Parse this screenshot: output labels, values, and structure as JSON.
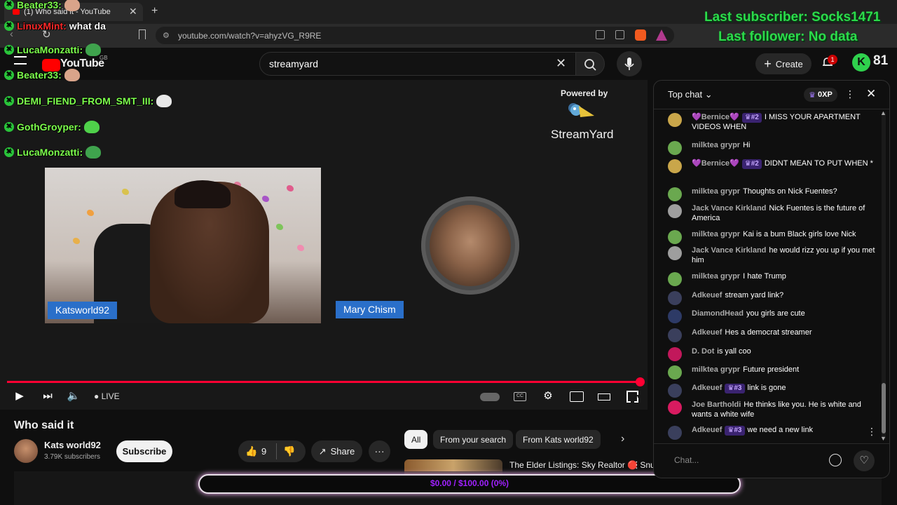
{
  "browser": {
    "tab_title": "(1) Who said it - YouTube",
    "url": "youtube.com/watch?v=ahyzVG_R9RE"
  },
  "youtube": {
    "logo": "YouTube",
    "logo_region": "GB",
    "search_query": "streamyard",
    "create_label": "Create",
    "notification_count": "1"
  },
  "player": {
    "powered_by": "Powered by",
    "streamyard_logo": "StreamYard",
    "participant_1": "Katsworld92",
    "participant_2": "Mary Chism",
    "live_label": "LIVE",
    "progress_fraction": 1.0
  },
  "video": {
    "title": "Who said it",
    "channel_name": "Kats world92",
    "subscribers": "3.79K subscribers",
    "subscribe_label": "Subscribe",
    "likes": "9",
    "share_label": "Share"
  },
  "chips": [
    "All",
    "From your search",
    "From Kats world92"
  ],
  "recommendation": {
    "title": "The Elder Listings: Sky Realtor 🔴 Snuffed Realtor"
  },
  "goal": {
    "text": "$0.00 / $100.00 (0%)"
  },
  "chat": {
    "header": "Top chat",
    "xp": "0XP",
    "input_placeholder": "Chat...",
    "messages": [
      {
        "author": "💜Bernice💜",
        "badge": "#2",
        "text": "I MISS YOUR APARTMENT VIDEOS WHEN",
        "color": "#c9a64a"
      },
      {
        "author": "milktea grypr",
        "badge": "",
        "text": "Hi",
        "color": "#6aa84f"
      },
      {
        "author": "💜Bernice💜",
        "badge": "#2",
        "text": "DIDNT MEAN TO PUT WHEN *",
        "color": "#c9a64a"
      },
      {
        "author": "milktea grypr",
        "badge": "",
        "text": "Thoughts on Nick Fuentes?",
        "color": "#6aa84f"
      },
      {
        "author": "Jack Vance Kirkland",
        "badge": "",
        "text": "Nick Fuentes is the future of America",
        "color": "#9e9e9e"
      },
      {
        "author": "milktea grypr",
        "badge": "",
        "text": "Kai is a bum Black girls love Nick",
        "color": "#6aa84f"
      },
      {
        "author": "Jack Vance Kirkland",
        "badge": "",
        "text": "he would rizz you up if you met him",
        "color": "#9e9e9e"
      },
      {
        "author": "milktea grypr",
        "badge": "",
        "text": "I hate Trump",
        "color": "#6aa84f"
      },
      {
        "author": "Adkeuef",
        "badge": "",
        "text": "stream yard link?",
        "color": "#3a3f5c"
      },
      {
        "author": "DiamondHead",
        "badge": "",
        "text": "you girls are cute",
        "color": "#2d3a66"
      },
      {
        "author": "Adkeuef",
        "badge": "",
        "text": "Hes a democrat streamer",
        "color": "#3a3f5c"
      },
      {
        "author": "D. Dot",
        "badge": "",
        "text": "is yall coo",
        "color": "#c2185b"
      },
      {
        "author": "milktea grypr",
        "badge": "",
        "text": "Future president",
        "color": "#6aa84f"
      },
      {
        "author": "Adkeuef",
        "badge": "#3",
        "text": "link is gone",
        "color": "#3a3f5c"
      },
      {
        "author": "Joe Bartholdi",
        "badge": "",
        "text": "He thinks like you. He is white and wants a white wife",
        "color": "#d81b60"
      },
      {
        "author": "Adkeuef",
        "badge": "#3",
        "text": "we need a new link",
        "color": "#3a3f5c"
      }
    ]
  },
  "overlay": {
    "last_subscriber": "Last subscriber: Socks1471",
    "last_follower": "Last follower: No data",
    "view_count": "81",
    "user_initial": "K",
    "chat_lines": [
      {
        "user": "Beater33:",
        "text": ""
      },
      {
        "user": "LinuxMint:",
        "text": "what da"
      },
      {
        "user": "LucaMonzatti:",
        "text": ""
      },
      {
        "user": "Beater33:",
        "text": ""
      },
      {
        "user": "DEMI_FIEND_FROM_SMT_III:",
        "text": ""
      },
      {
        "user": "GothGroyper:",
        "text": ""
      },
      {
        "user": "LucaMonzatti:",
        "text": ""
      }
    ]
  }
}
